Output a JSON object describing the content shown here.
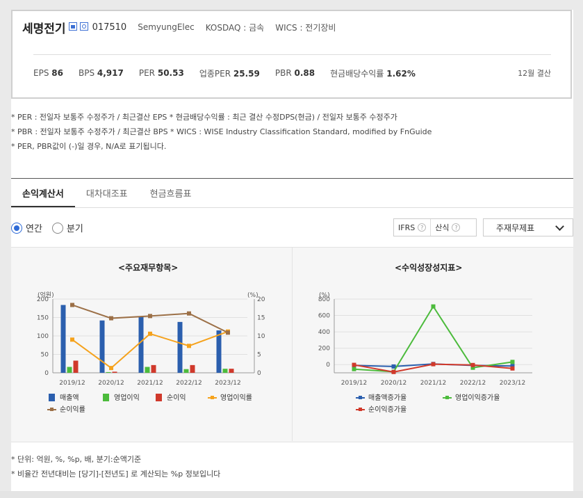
{
  "company": {
    "name": "세명전기",
    "code": "017510",
    "english_name": "SemyungElec",
    "market": "KOSDAQ : 금속",
    "wics": "WICS : 전기장비",
    "home_icon": "home-icon",
    "report_icon": "report-icon"
  },
  "metrics": {
    "eps_label": "EPS",
    "eps_value": "86",
    "bps_label": "BPS",
    "bps_value": "4,917",
    "per_label": "PER",
    "per_value": "50.53",
    "industry_per_label": "업종PER",
    "industry_per_value": "25.59",
    "pbr_label": "PBR",
    "pbr_value": "0.88",
    "dividend_label": "현금배당수익률",
    "dividend_value": "1.62%",
    "settlement": "12월 결산"
  },
  "notes": [
    "* PER : 전일자 보통주 수정주가 / 최근결산 EPS * 현금배당수익률 : 최근 결산 수정DPS(현금) / 전일자 보통주 수정주가",
    "* PBR : 전일자 보통주 수정주가 / 최근결산 BPS * WICS : WISE Industry Classification Standard, modified by FnGuide",
    "* PER, PBR값이 (-)일 경우, N/A로 표기됩니다."
  ],
  "tabs": [
    "손익계산서",
    "대차대조표",
    "현금흐름표"
  ],
  "period": {
    "annual": "연간",
    "quarterly": "분기"
  },
  "options": {
    "ifrs": "IFRS",
    "ifrs_help": "?",
    "calc": "산식",
    "calc_help": "?",
    "select_value": "주재무제표"
  },
  "chart_titles": {
    "left": "<주요재무항목>",
    "right": "<수익성장성지표>"
  },
  "chart_data": [
    {
      "type": "bar",
      "title": "<주요재무항목>",
      "ylabel": "(억원)",
      "y2label": "(%)",
      "ylim": [
        0,
        200
      ],
      "y2lim": [
        0,
        20
      ],
      "yticks": [
        "0",
        "50",
        "100",
        "150",
        "200"
      ],
      "y2ticks": [
        "0",
        "5",
        "10",
        "15",
        "20"
      ],
      "categories": [
        "2019/12",
        "2020/12",
        "2021/12",
        "2022/12",
        "2023/12"
      ],
      "series": [
        {
          "name": "매출액",
          "kind": "bar",
          "axis": "left",
          "color": "#2b5fae",
          "values": [
            184,
            142,
            153,
            138,
            115
          ]
        },
        {
          "name": "영업이익",
          "kind": "bar",
          "axis": "left",
          "color": "#4cbb3c",
          "values": [
            16,
            2,
            16,
            10,
            11
          ]
        },
        {
          "name": "순이익",
          "kind": "bar",
          "axis": "left",
          "color": "#d0392b",
          "values": [
            33,
            3,
            21,
            21,
            11
          ]
        },
        {
          "name": "영업이익률",
          "kind": "line",
          "axis": "right",
          "color": "#f5a21c",
          "values": [
            9.0,
            1.3,
            10.6,
            7.3,
            11.2
          ]
        },
        {
          "name": "순이익률",
          "kind": "line",
          "axis": "right",
          "color": "#9c7047",
          "values": [
            18.4,
            14.8,
            15.4,
            16.1,
            10.9
          ]
        }
      ],
      "legend_position": "bottom"
    },
    {
      "type": "line",
      "title": "<수익성장성지표>",
      "ylabel": "(%)",
      "ylim": [
        -100,
        800
      ],
      "yticks": [
        "0",
        "200",
        "400",
        "600",
        "800"
      ],
      "categories": [
        "2019/12",
        "2020/12",
        "2021/12",
        "2022/12",
        "2023/12"
      ],
      "series": [
        {
          "name": "매출액증가율",
          "color": "#2b5fae",
          "values": [
            -10,
            -23,
            8,
            -10,
            -17
          ]
        },
        {
          "name": "영업이익증가율",
          "color": "#4cbb3c",
          "values": [
            -55,
            -87,
            710,
            -38,
            33
          ]
        },
        {
          "name": "순이익증가율",
          "color": "#d0392b",
          "values": [
            -3,
            -90,
            5,
            -5,
            -47
          ]
        }
      ],
      "legend_position": "bottom"
    }
  ],
  "footer_notes": [
    "* 단위: 억원, %, %p, 배, 분기:순액기준",
    "* 비율간 전년대비는 [당기]-[전년도] 로 계산되는 %p 정보입니다"
  ]
}
